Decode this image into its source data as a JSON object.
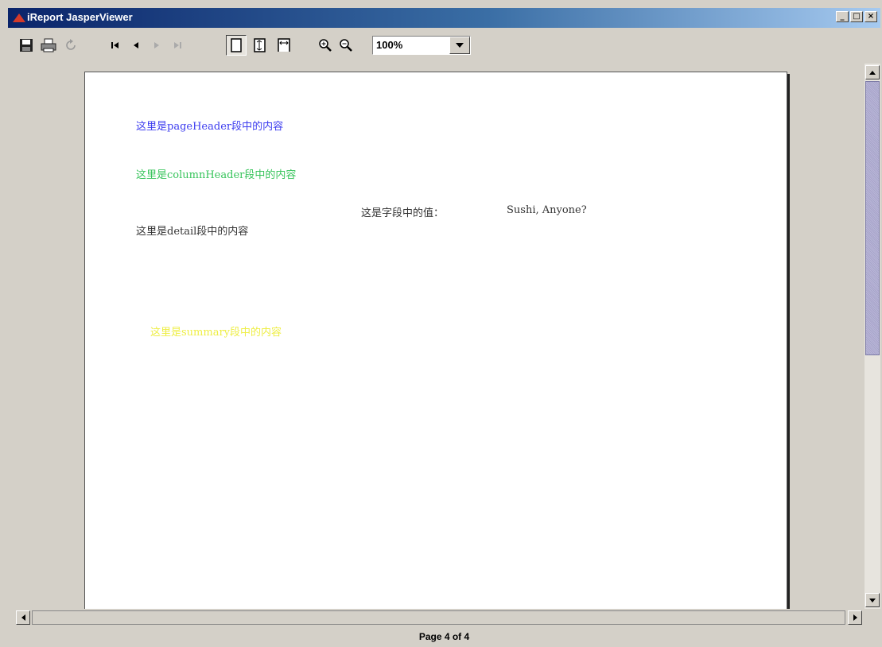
{
  "window": {
    "title": "iReport JasperViewer",
    "controls": [
      "_",
      "□",
      "×"
    ]
  },
  "toolbar": {
    "buttons": [
      {
        "name": "save-icon"
      },
      {
        "name": "print-icon"
      },
      {
        "name": "reload-icon"
      },
      {
        "name": "first-page-icon"
      },
      {
        "name": "previous-page-icon"
      },
      {
        "name": "next-page-icon"
      },
      {
        "name": "last-page-icon"
      },
      {
        "name": "actual-size-icon"
      },
      {
        "name": "fit-page-icon"
      },
      {
        "name": "fit-width-icon"
      },
      {
        "name": "zoom-in-icon"
      },
      {
        "name": "zoom-out-icon"
      }
    ],
    "zoom_value": "100%"
  },
  "report": {
    "page_header": "这里是pageHeader段中的内容",
    "column_header": "这里是columnHeader段中的内容",
    "field_label": "这是字段中的值：",
    "field_value": "Sushi, Anyone?",
    "detail": "这里是detail段中的内容",
    "summary": "这里是summary段中的内容",
    "colors": {
      "page_header": "#3b3bef",
      "column_header": "#37c45b",
      "detail": "#333333",
      "summary": "#eeee44"
    }
  },
  "status": {
    "page_text": "Page 4 of 4"
  }
}
